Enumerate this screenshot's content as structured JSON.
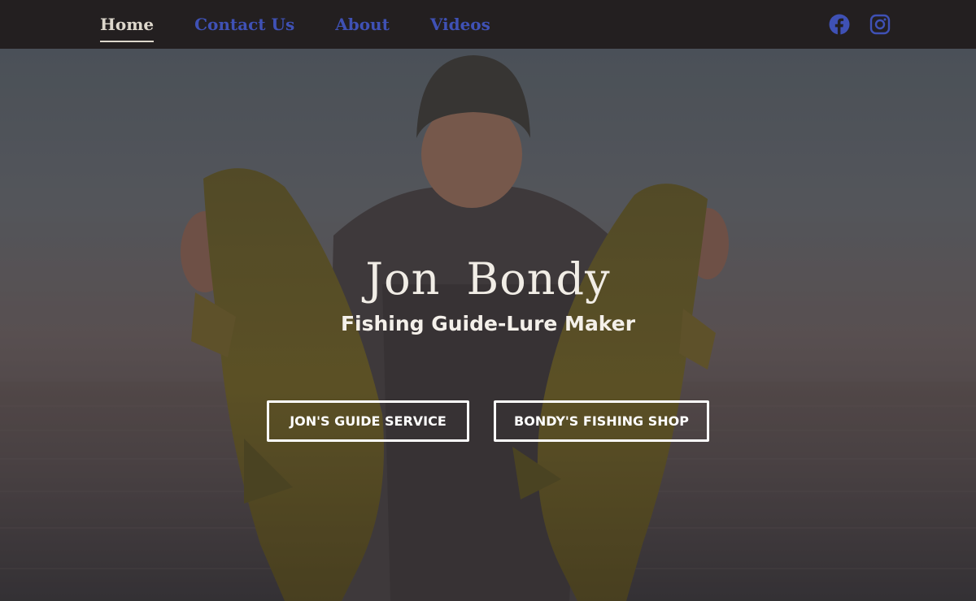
{
  "nav": {
    "items": [
      {
        "label": "Home",
        "active": true
      },
      {
        "label": "Contact Us",
        "active": false
      },
      {
        "label": "About",
        "active": false
      },
      {
        "label": "Videos",
        "active": false
      }
    ]
  },
  "social": {
    "facebook_icon": "facebook-icon",
    "instagram_icon": "instagram-icon",
    "icon_color": "#3f51b5"
  },
  "hero": {
    "title": "Jon  Bondy",
    "subtitle": "Fishing Guide-Lure Maker",
    "buttons": [
      {
        "label": "JON'S GUIDE SERVICE"
      },
      {
        "label": "BONDY'S FISHING SHOP"
      }
    ]
  },
  "colors": {
    "topbar": "#231f20",
    "nav_link": "#3f51b5",
    "nav_active": "#ddd7cc"
  }
}
